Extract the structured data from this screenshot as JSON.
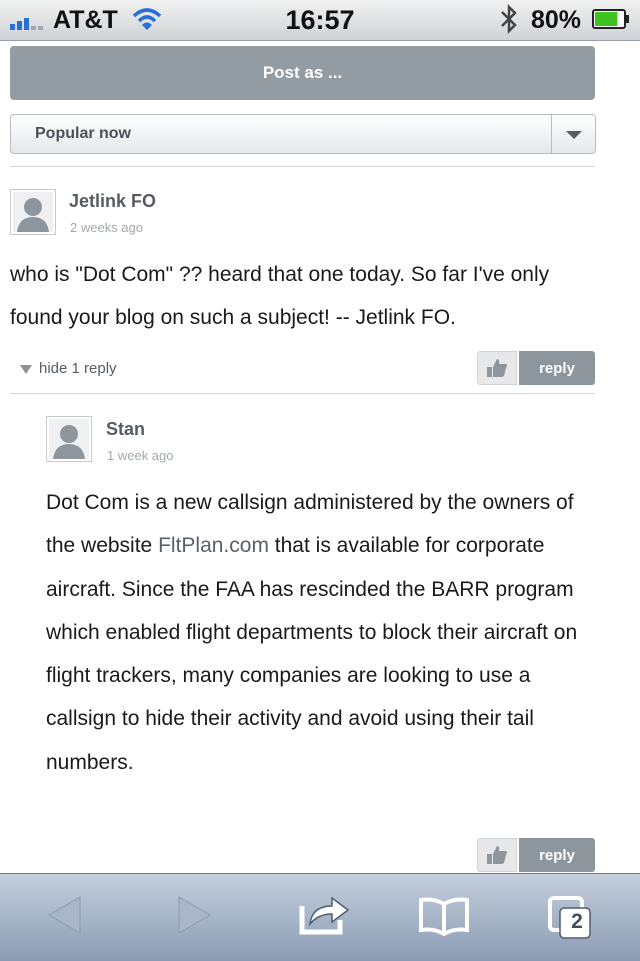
{
  "status_bar": {
    "carrier": "AT&T",
    "time": "16:57",
    "battery_percent": "80%",
    "battery_level": 0.8,
    "icons": [
      "signal-bars-icon",
      "wifi-icon",
      "bluetooth-icon",
      "battery-icon"
    ]
  },
  "comments_header": {
    "post_as_label": "Post as ...",
    "sort_selected": "Popular now"
  },
  "comments": [
    {
      "author": "Jetlink FO",
      "time_ago": "2 weeks ago",
      "text": "who is \"Dot Com\" ?? heard that one today. So far I've only found your blog on such a subject!  -- Jetlink FO.",
      "replies_toggle": "hide 1 reply",
      "reply_label": "reply"
    },
    {
      "author": "Stan",
      "time_ago": "1 week ago",
      "text_before_link": "Dot Com is a new callsign administered by the owners of the website ",
      "link_text": "FltPlan.com",
      "text_after_link": " that is available for corporate aircraft. Since the FAA has rescinded the BARR program which enabled flight departments to block their aircraft on flight trackers, many companies are looking to use a callsign to hide their activity and avoid using their tail numbers.",
      "reply_label": "reply"
    }
  ],
  "toolbar": {
    "tabs_count": "2",
    "icons": [
      "back-arrow-icon",
      "forward-arrow-icon",
      "share-icon",
      "bookmarks-icon",
      "tabs-icon"
    ]
  },
  "colors": {
    "button_gray": "#949ca3",
    "toolbar_top": "#c4cfdd",
    "toolbar_bottom": "#8a9bb3",
    "battery_green": "#3ec21f"
  }
}
